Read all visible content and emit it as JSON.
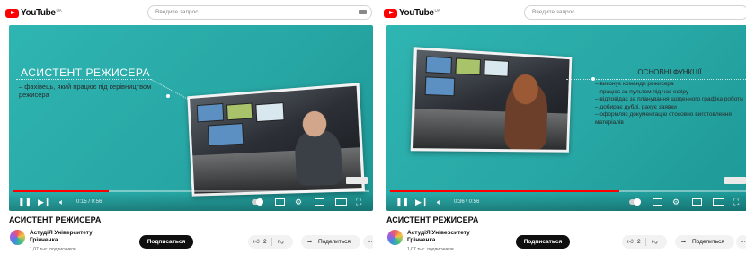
{
  "youtube": {
    "logo_text": "YouTube",
    "region": "UA",
    "search_placeholder": "Введите запрос"
  },
  "panels": [
    {
      "slide": {
        "title": "АСИСТЕНТ РЕЖИСЕРА",
        "description": "– фахівець, який працює під керівництвом режисера"
      },
      "player": {
        "time": "0:15 / 0:56",
        "progress": 0.27
      },
      "video_title": "АСИСТЕНТ РЕЖИСЕРА",
      "channel_name": "АстудіЯ Університету Грінченка",
      "subscribers": "1,07 тыс. подписчиков",
      "subscribe_label": "Подписаться",
      "likes": "2",
      "share_label": "Поделиться"
    },
    {
      "slide": {
        "title": "ОСНОВНІ ФУНКЦІЇ",
        "items": [
          "– виконує команди режисера",
          "– працює за пультом під час ефіру",
          "– відповідає за планування щоденного графіка роботи",
          "– добирає дублі, рахує заявки",
          "– оформляє документацію стосовно виготовлення матеріалів"
        ]
      },
      "player": {
        "time": "0:36 / 0:56",
        "progress": 0.64
      },
      "video_title": "АСИСТЕНТ РЕЖИСЕРА",
      "channel_name": "АстудіЯ Університету Грінченка",
      "subscribers": "1,07 тыс. подписчиков",
      "subscribe_label": "Подписаться",
      "likes": "2",
      "share_label": "Поделиться"
    }
  ],
  "icons": {
    "play": "play-pause-icon",
    "next": "next-icon",
    "volume": "volume-icon",
    "autoplay": "autoplay-toggle",
    "subtitles": "subtitles-icon",
    "settings": "gear-icon",
    "miniplayer": "miniplayer-icon",
    "theater": "theater-icon",
    "fullscreen": "fullscreen-icon",
    "like": "thumbs-up-icon",
    "dislike": "thumbs-down-icon",
    "share": "share-icon",
    "more": "more-icon"
  },
  "colors": {
    "brand_red": "#ff0000",
    "video_bg": "#2fb5b2",
    "subscribe_bg": "#0f0f0f"
  }
}
